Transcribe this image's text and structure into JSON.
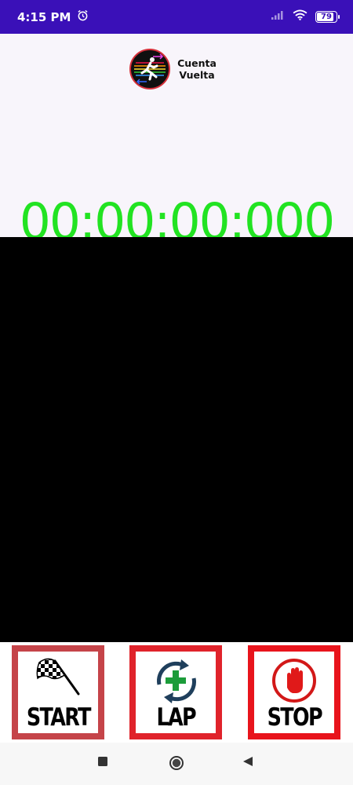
{
  "status_bar": {
    "time": "4:15 PM",
    "battery": "79",
    "battery_level": 0.79,
    "icons": [
      "alarm-icon",
      "signal-icon",
      "wifi-icon",
      "battery-icon"
    ]
  },
  "app": {
    "title_line1": "Cuenta",
    "title_line2": "Vuelta",
    "logo": "runner-logo-icon"
  },
  "timer": {
    "value": "00:00:00:000",
    "color": "#22e322"
  },
  "controls": {
    "start_label": "START",
    "lap_label": "LAP",
    "stop_label": "STOP",
    "start_icon": "checkered-flag-icon",
    "lap_icon": "add-lap-icon",
    "stop_icon": "stop-hand-icon"
  },
  "nav": {
    "icons": [
      "recents-icon",
      "home-icon",
      "back-icon"
    ]
  },
  "colors": {
    "status_bar": "#3a10b8",
    "button_border": "#d91f26",
    "lap_area": "#000000"
  }
}
